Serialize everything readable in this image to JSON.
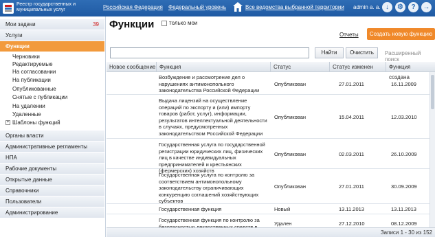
{
  "header": {
    "app_name": "Реестр государственных и муниципальных услуг",
    "links": [
      "Российская Федерация",
      "Федеральный уровень",
      "Все ведомства выбранной территории"
    ],
    "user": "admin a. a."
  },
  "sidebar": {
    "my_tasks": {
      "label": "Мои задачи",
      "count": "39"
    },
    "services": "Услуги",
    "functions": "Функции",
    "sub_items": [
      "Черновики",
      "Редактируемые",
      "На согласовании",
      "На публикации",
      "Опубликованные",
      "Снятые с публикации",
      "На удалении",
      "Удаленные"
    ],
    "templates": "Шаблоны функций",
    "sections": [
      "Органы власти",
      "Административные регламенты",
      "НПА",
      "Рабочие документы",
      "Открытые данные",
      "Справочники",
      "Пользователи",
      "Администрирование"
    ]
  },
  "main": {
    "title": "Функции",
    "only_mine": "только мои",
    "reports": "Отчеты",
    "create_button": "Создать новую функцию",
    "search_placeholder": "",
    "find_button": "Найти",
    "clear_button": "Очистить",
    "advanced_search": "Расширенный поиск"
  },
  "table": {
    "columns": [
      "Новое сообщение",
      "Функция",
      "Статус",
      "Статус изменен",
      "Функция создана"
    ],
    "rows": [
      {
        "message": "",
        "function": "Возбуждение и рассмотрение дел о нарушениях антимонопольного законодательства Российской Федерации",
        "status": "Опубликован",
        "changed": "27.01.2011",
        "created": "16.11.2009"
      },
      {
        "message": "",
        "function": "Выдача лицензий на осуществление операций по экспорту и (или) импорту товаров (работ, услуг), информации, результатов интеллектуальной деятельности в случаях, предусмотренных законодательством Российской Федерации",
        "status": "Опубликован",
        "changed": "15.04.2011",
        "created": "12.03.2010"
      },
      {
        "message": "",
        "function": "Государственная услуга по государственной регистрации юридических лиц, физических лиц в качестве индивидуальных предпринимателей и крестьянских (фермерских) хозяйств",
        "status": "Опубликован",
        "changed": "02.03.2011",
        "created": "26.10.2009"
      },
      {
        "message": "",
        "function": "Государственная услуга по контролю за соответствием антимонопольному законодательству ограничивающих конкуренцию соглашений хозяйствующих субъектов",
        "status": "Опубликован",
        "changed": "27.01.2011",
        "created": "30.09.2009"
      },
      {
        "message": "",
        "function": "Государственная функция",
        "status": "Новый",
        "changed": "13.11.2013",
        "created": "13.11.2013"
      },
      {
        "message": "",
        "function": "Государственная функция по контролю за безопасностью лекарственных средств в ходе клинических исследований",
        "status": "Удален",
        "changed": "27.12.2010",
        "created": "08.12.2009"
      }
    ]
  },
  "footer": {
    "records": "Записи 1 - 30 из 152"
  }
}
